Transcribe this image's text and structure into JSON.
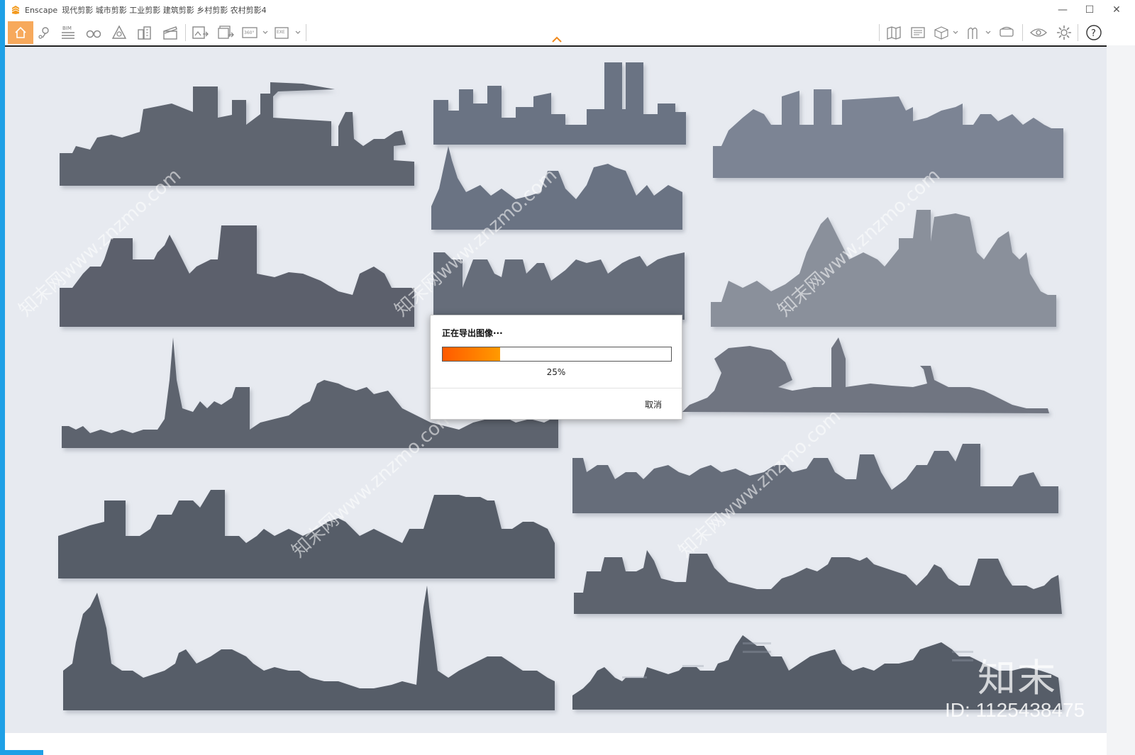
{
  "window": {
    "app_name": "Enscape",
    "title": "现代剪影 城市剪影 工业剪影 建筑剪影 乡村剪影 农村剪影4",
    "controls": {
      "minimize": "—",
      "maximize": "☐",
      "close": "✕"
    }
  },
  "toolbar": {
    "left_icons": [
      "home-icon",
      "location-pin-icon",
      "bim-icon",
      "binoculars-icon",
      "sun-icon",
      "buildings-icon",
      "clapper-icon",
      "render-image-icon",
      "batch-render-icon",
      "render-360-icon",
      "export-exe-icon"
    ],
    "bim_label": "BIM",
    "label_360": "360°",
    "label_exe": "EXE",
    "right_icons": [
      "map-icon",
      "screenshot-icon",
      "cube-icon",
      "walk-icon",
      "vr-headset-icon",
      "eye-icon",
      "gear-icon",
      "help-icon"
    ],
    "help_label": "?"
  },
  "dialog": {
    "title": "正在导出图像···",
    "progress_percent": 25,
    "progress_text": "25%",
    "cancel_label": "取消"
  },
  "watermark": {
    "logo_text": "知末",
    "id_text": "ID: 1125438475",
    "diagonal_text": "知末网www.znzmo.com"
  },
  "colors": {
    "accent_blue": "#1fa0e6",
    "home_active": "#f7a95c",
    "progress_start": "#ff5a00",
    "progress_end": "#ff9a00",
    "silhouette_dark": "#55595f",
    "silhouette_mid": "#6b7280",
    "silhouette_light": "#7f8591",
    "wall": "#e7eaf0"
  }
}
